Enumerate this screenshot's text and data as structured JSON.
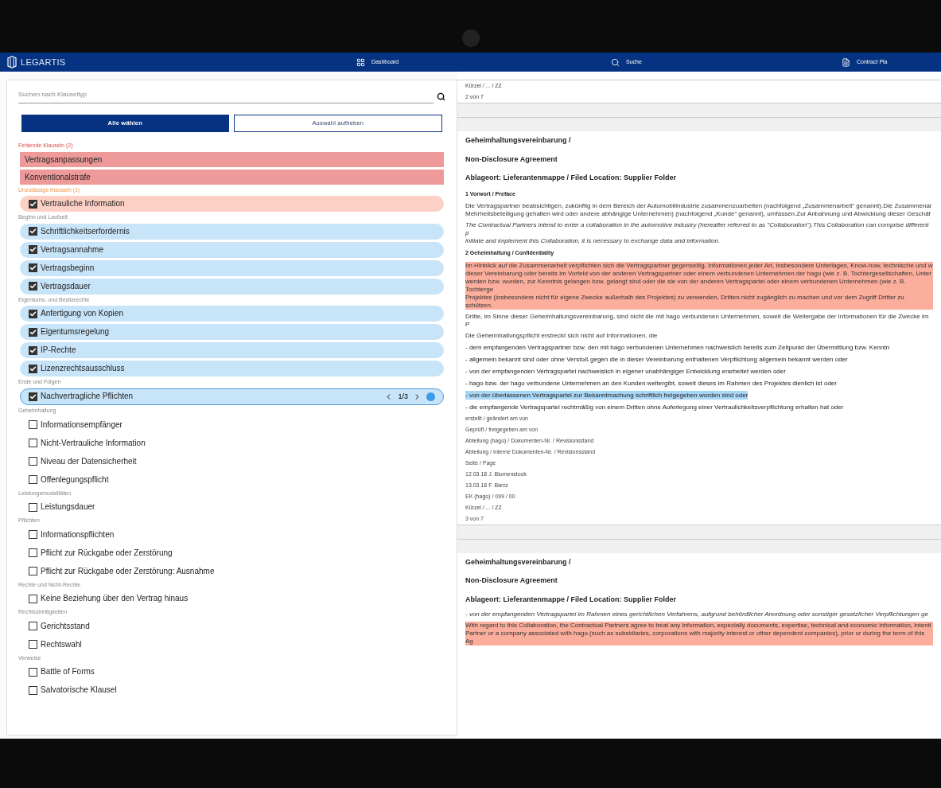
{
  "nav": {
    "logo": "LEGARTIS",
    "items": [
      {
        "label": "Dashboard"
      },
      {
        "label": "Suche"
      },
      {
        "label": "Contract Pla"
      }
    ]
  },
  "sidebar": {
    "search": {
      "placeholder": "Suchen nach Klauseltyp"
    },
    "buttons": [
      {
        "label": "Alle wählen",
        "kind": "primary"
      },
      {
        "label": "Auswahl aufheben",
        "kind": "outline"
      }
    ],
    "groups": [
      {
        "title": "Fehlende Klauseln (2)",
        "kind": "missing",
        "items": [
          {
            "label": "Vertragsanpassungen"
          },
          {
            "label": "Konventionalstrafe"
          }
        ]
      },
      {
        "title": "Unzulässige Klauseln (1)",
        "kind": "invalid",
        "items": [
          {
            "label": "Vertrauliche Information",
            "checked": true,
            "selected": false
          }
        ]
      },
      {
        "title": "Beginn und Laufzeit",
        "kind": "normal",
        "items": [
          {
            "label": "Schriftlichkeitserfordernis",
            "checked": true,
            "selected": false
          },
          {
            "label": "Vertragsannahme",
            "checked": true,
            "selected": false
          },
          {
            "label": "Vertragsbeginn",
            "checked": true,
            "selected": false
          },
          {
            "label": "Vertragsdauer",
            "checked": true,
            "selected": false
          }
        ]
      },
      {
        "title": "Eigentums- und Besitzrechte",
        "kind": "normal",
        "items": [
          {
            "label": "Anfertigung von Kopien",
            "checked": true,
            "selected": false
          },
          {
            "label": "Eigentumsregelung",
            "checked": true,
            "selected": false
          },
          {
            "label": "IP-Rechte",
            "checked": true,
            "selected": false
          },
          {
            "label": "Lizenzrechtsausschluss",
            "checked": true,
            "selected": false
          }
        ]
      },
      {
        "title": "Ende und Folgen",
        "kind": "normal",
        "items": [
          {
            "label": "Nachvertragliche Pflichten",
            "checked": true,
            "selected": true,
            "pager": "1/3"
          }
        ]
      },
      {
        "title": "Geheimhaltung",
        "kind": "normal",
        "items": [
          {
            "label": "Informationsempfänger",
            "checked": false,
            "selected": false
          },
          {
            "label": "Nicht-Vertrauliche Information",
            "checked": false,
            "selected": false
          },
          {
            "label": "Niveau der Datensicherheit",
            "checked": false,
            "selected": false
          },
          {
            "label": "Offenlegungspflicht",
            "checked": false,
            "selected": false
          }
        ]
      },
      {
        "title": "Leistungsmodalitäten",
        "kind": "normal",
        "items": [
          {
            "label": "Leistungsdauer",
            "checked": false,
            "selected": false
          }
        ]
      },
      {
        "title": "Pflichten",
        "kind": "normal",
        "items": [
          {
            "label": "Informationspflichten",
            "checked": false,
            "selected": false
          },
          {
            "label": "Pflicht zur Rückgabe oder Zerstörung",
            "checked": false,
            "selected": false
          },
          {
            "label": "Pflicht zur Rückgabe oder Zerstörung: Ausnahme",
            "checked": false,
            "selected": false
          }
        ]
      },
      {
        "title": "Rechte und Nicht-Rechte",
        "kind": "normal",
        "items": [
          {
            "label": "Keine Beziehung über den Vertrag hinaus",
            "checked": false,
            "selected": false
          }
        ]
      },
      {
        "title": "Rechtsstreitigkeiten",
        "kind": "normal",
        "items": [
          {
            "label": "Gerichtsstand",
            "checked": false,
            "selected": false
          },
          {
            "label": "Rechtswahl",
            "checked": false,
            "selected": false
          }
        ]
      },
      {
        "title": "Verweise",
        "kind": "normal",
        "items": [
          {
            "label": "Battle of Forms",
            "checked": false,
            "selected": false
          },
          {
            "label": "Salvatorische Klausel",
            "checked": false,
            "selected": false
          }
        ]
      }
    ]
  },
  "document": [
    {
      "kind": "meta",
      "text": "Kürzel / ... / ZZ"
    },
    {
      "kind": "meta",
      "text": "2 von 7"
    },
    {
      "kind": "separator"
    },
    {
      "kind": "separator"
    },
    {
      "kind": "title",
      "text": "Geheimhaltungsvereinbarung /"
    },
    {
      "kind": "title",
      "text": "Non-Disclosure Agreement"
    },
    {
      "kind": "title",
      "text": "Ablageort: Lieferantenmappe / Filed Location: Supplier Folder"
    },
    {
      "kind": "heading",
      "text": "1 Vorwort / Preface"
    },
    {
      "kind": "para",
      "italic": false,
      "lines": [
        "Die Vertragspartner beabsichtigen, zukünftig in dem Bereich der Automobilindustrie zusammenzuarbeiten (nachfolgend „Zusammenarbeit“ genannt).Die Zusammenar",
        "Mehrheitsbeteiligung gehalten wird oder andere abhängige Unternehmen) (nachfolgend „Kunde“ genannt), umfassen.Zur Anbahnung und Abwicklung dieser Geschäf"
      ]
    },
    {
      "kind": "para",
      "italic": true,
      "lines": [
        "The Contractual Partners intend to enter a collaboration in the automotive industry (hereafter referred to as \"Collaboration\").This Collaboration can comprise different p",
        "initiate and implement this Collaboration, it is necessary to exchange data and information."
      ]
    },
    {
      "kind": "heading",
      "text": "2 Geheimhaltung / Confidentiality"
    },
    {
      "kind": "para",
      "color": "#fbae9c",
      "italic": false,
      "lines": [
        "Im Hinblick auf die Zusammenarbeit verpflichten sich die Vertragspartner gegenseitig, Informationen jeder Art, insbesondere Unterlagen, Know-how, technische und w",
        "dieser Vereinbarung oder bereits im Vorfeld von der anderen Vertragspartner oder einem verbundenen Unternehmen der hago (wie z. B. Tochtergesellschaften, Unter",
        "werden bzw. wurden, zur Kenntnis gelangen bzw. gelangt sind oder die sie von der anderen Vertragspartei oder einem verbundenen Unternehmen (wie z. B. Tochterge",
        "Projektes (insbesondere nicht für eigene Zwecke außerhalb des Projektes) zu verwenden, Dritten nicht zugänglich zu machen und vor dem Zugriff Dritter zu schützen."
      ]
    },
    {
      "kind": "para",
      "italic": false,
      "lines": [
        "Dritte, im Sinne dieser Geheimhaltungsvereinbarung, sind nicht die mit hago verbundenen Unternehmen, soweit die Weitergabe der Informationen für die Zwecke im P"
      ]
    },
    {
      "kind": "para",
      "italic": false,
      "lines": [
        "Die Geheimhaltungspflicht erstreckt sich nicht auf Informationen, die"
      ]
    },
    {
      "kind": "bullet",
      "text": "- dem empfangenden Vertragspartner bzw. den mit hago verbundenen Unternehmen nachweislich bereits zum Zeitpunkt der Übermittlung bzw. Kenntn"
    },
    {
      "kind": "bullet",
      "text": "- allgemein bekannt sind oder ohne Verstoß gegen die in dieser Vereinbarung enthaltenen Verpflichtung allgemein bekannt werden oder"
    },
    {
      "kind": "bullet",
      "text": "- von der empfangenden Vertragspartei nachweislich in eigener unabhängiger Entwicklung erarbeitet werden oder"
    },
    {
      "kind": "bullet",
      "text": "- hago bzw. der hago verbundene Unternehmen an den Kunden weitergibt, soweit dieses im Rahmen des Projektes dienlich ist oder"
    },
    {
      "kind": "bullet",
      "color": "#a9d6f5",
      "text": "- von der überlassenen Vertragspartei zur Bekanntmachung schriftlich freigegeben worden sind oder"
    },
    {
      "kind": "bullet",
      "text": "- die empfangende Vertragspartei rechtmäßig von einem Dritten ohne Auferlegung einer Vertraulichkeitsverpflichtung erhalten hat oder"
    },
    {
      "kind": "meta",
      "text": "erstellt / geändert am von"
    },
    {
      "kind": "meta",
      "text": "Geprüft / freigegeben am von"
    },
    {
      "kind": "meta",
      "text": "Abteilung (hago) / Dokumenten-Nr. / Revisionsstand"
    },
    {
      "kind": "meta",
      "text": "Abteilung / Interne Dokumenten-Nr. / Revisionsstand"
    },
    {
      "kind": "meta",
      "text": "Seite / Page"
    },
    {
      "kind": "meta",
      "text": "12.03.18 J. Blumenstock"
    },
    {
      "kind": "meta",
      "text": "13.03.18 F. Bienz"
    },
    {
      "kind": "meta",
      "text": "EK (hago) / 099 / 00"
    },
    {
      "kind": "meta",
      "text": "Kürzel / ... / ZZ"
    },
    {
      "kind": "meta",
      "text": "3 von 7"
    },
    {
      "kind": "separator"
    },
    {
      "kind": "separator"
    },
    {
      "kind": "title",
      "text": "Geheimhaltungsvereinbarung /"
    },
    {
      "kind": "title",
      "text": "Non-Disclosure Agreement"
    },
    {
      "kind": "title",
      "text": "Ablageort: Lieferantenmappe / Filed Location: Supplier Folder"
    },
    {
      "kind": "para",
      "italic": true,
      "lines": [
        "- von der empfangenden Vertragspartei im Rahmen eines gerichtlichen Verfahrens, aufgrund behördlicher Anordnung oder sonstiger gesetzlicher Verpflichtungen ge"
      ]
    },
    {
      "kind": "para",
      "color": "#fbae9c",
      "italic": false,
      "lines": [
        "With regard to this Collaboration, the Contractual Partners agree to treat any information, especially documents, expertise, technical and economic information, intenti",
        "Partner or a company associated with hago (such as subsidiaries, corporations with majority interest or other dependent companies), prior or during the term of this Ag"
      ]
    }
  ]
}
